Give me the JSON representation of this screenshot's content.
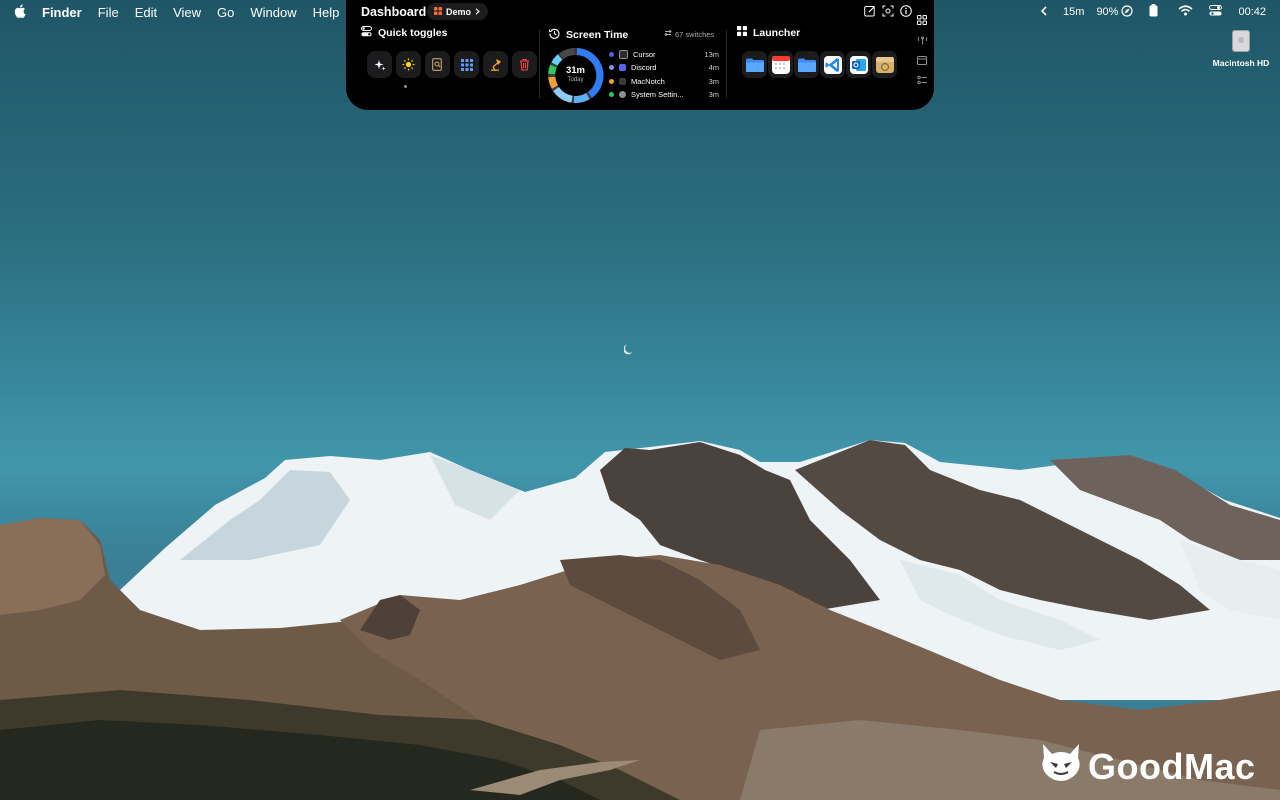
{
  "menubar": {
    "apple_icon": "apple-logo-icon",
    "app_name": "Finder",
    "menus": [
      "File",
      "Edit",
      "View",
      "Go",
      "Window",
      "Help"
    ],
    "timer": "15m",
    "battery_percent": "90%",
    "clock": "00:42"
  },
  "notch": {
    "title": "Dashboard",
    "profile": "Demo",
    "quick_toggles": {
      "title": "Quick toggles",
      "buttons": [
        "sparkles-icon",
        "sun-icon",
        "document-search-icon",
        "grid-icon",
        "lamp-icon",
        "trash-icon"
      ]
    },
    "screen_time": {
      "title": "Screen Time",
      "switches": "67 switches",
      "total": "31m",
      "total_label": "Today",
      "apps": [
        {
          "name": "Cursor",
          "time": "13m",
          "color": "#2f7cf6"
        },
        {
          "name": "Discord",
          "time": "4m",
          "color": "#5865f2"
        },
        {
          "name": "MacNotch",
          "time": "3m",
          "color": "#f0a030"
        },
        {
          "name": "System Settin...",
          "time": "3m",
          "color": "#34c759"
        }
      ]
    },
    "launcher": {
      "title": "Launcher",
      "apps": [
        "folder-icon",
        "calendar-icon",
        "folder-icon",
        "vscode-icon",
        "outlook-icon",
        "archive-utility-icon"
      ]
    }
  },
  "desktop": {
    "disk_label": "Macintosh HD"
  },
  "watermark": "GoodMac"
}
